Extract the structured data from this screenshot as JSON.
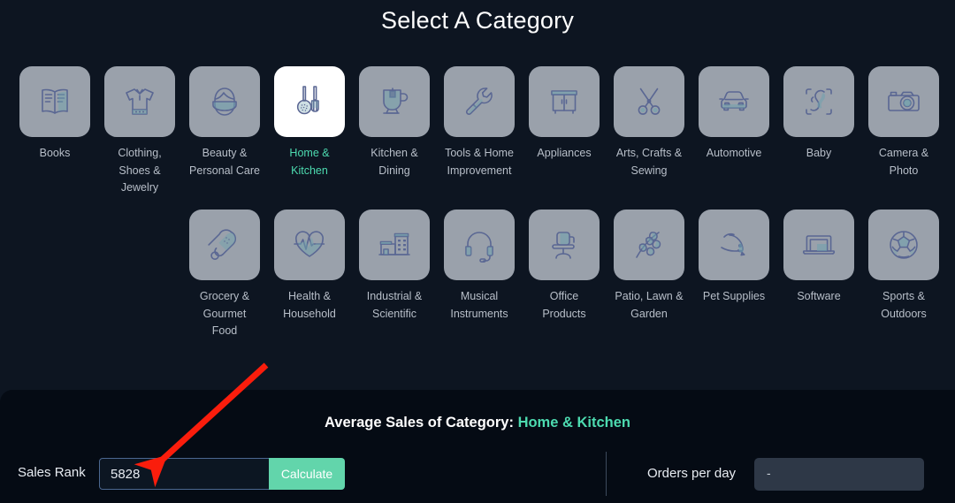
{
  "header": {
    "title": "Select A Category"
  },
  "categories": {
    "row1": [
      {
        "label": "Books",
        "icon": "book-icon",
        "selected": false
      },
      {
        "label": "Clothing, Shoes & Jewelry",
        "icon": "shirt-icon",
        "selected": false
      },
      {
        "label": "Beauty & Personal Care",
        "icon": "face-mask-icon",
        "selected": false
      },
      {
        "label": "Home & Kitchen",
        "icon": "kitchen-utensils-icon",
        "selected": true
      },
      {
        "label": "Kitchen & Dining",
        "icon": "mug-icon",
        "selected": false
      },
      {
        "label": "Tools & Home Improvement",
        "icon": "wrench-icon",
        "selected": false
      },
      {
        "label": "Appliances",
        "icon": "cabinet-icon",
        "selected": false
      },
      {
        "label": "Arts, Crafts & Sewing",
        "icon": "scissors-icon",
        "selected": false
      },
      {
        "label": "Automotive",
        "icon": "car-icon",
        "selected": false
      },
      {
        "label": "Baby",
        "icon": "baby-icon",
        "selected": false
      },
      {
        "label": "Camera & Photo",
        "icon": "camera-icon",
        "selected": false
      }
    ],
    "row2": [
      {
        "label": "Grocery & Gourmet Food",
        "icon": "drumstick-icon",
        "selected": false
      },
      {
        "label": "Health & Household",
        "icon": "heart-pulse-icon",
        "selected": false
      },
      {
        "label": "Industrial & Scientific",
        "icon": "factory-icon",
        "selected": false
      },
      {
        "label": "Musical Instruments",
        "icon": "headset-icon",
        "selected": false
      },
      {
        "label": "Office Products",
        "icon": "office-chair-icon",
        "selected": false
      },
      {
        "label": "Patio, Lawn & Garden",
        "icon": "plant-branch-icon",
        "selected": false
      },
      {
        "label": "Pet Supplies",
        "icon": "dog-icon",
        "selected": false
      },
      {
        "label": "Software",
        "icon": "laptop-icon",
        "selected": false
      },
      {
        "label": "Sports & Outdoors",
        "icon": "soccer-ball-icon",
        "selected": false
      }
    ]
  },
  "results": {
    "average_prefix": "Average Sales of Category:",
    "average_category": "Home & Kitchen",
    "sales_rank_label": "Sales Rank",
    "sales_rank_value": "5828",
    "sales_rank_placeholder": "Sales Rank",
    "calculate_label": "Calculate",
    "orders_per_day_label": "Orders per day",
    "orders_per_day_value": "-"
  },
  "colors": {
    "background": "#0d1521",
    "panel": "#050b14",
    "tile": "#9aa1ab",
    "tile_selected": "#ffffff",
    "accent_green": "#4ddbb0",
    "button_green": "#62d5ab",
    "input_border": "#4b6790",
    "annotation_red": "#fa1d0c",
    "label_text": "#b8bfc9"
  },
  "annotation": {
    "type": "arrow",
    "color": "#fa1d0c",
    "points_to": "sales-rank-input"
  }
}
